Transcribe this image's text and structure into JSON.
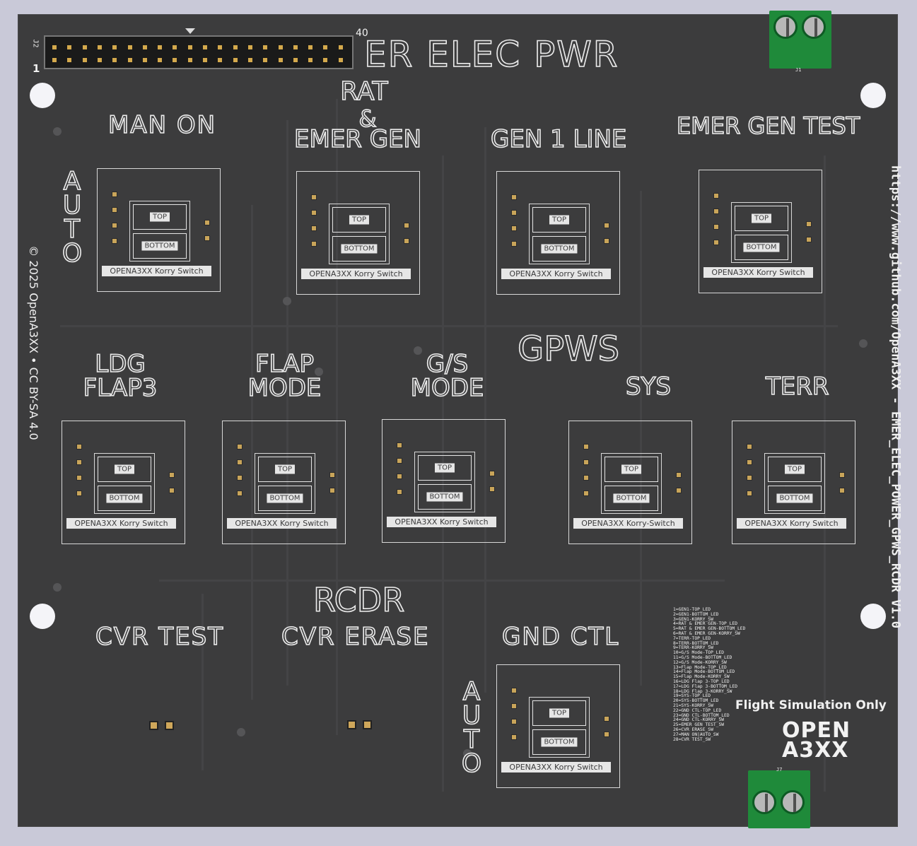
{
  "board": {
    "headers": {
      "title_top": "ER ELEC PWR",
      "rat_emer_gen": [
        "RAT",
        "&",
        "EMER GEN"
      ],
      "man_on": "MAN ON",
      "gen1_line": "GEN 1 LINE",
      "emer_gen_test": "EMER GEN TEST",
      "gpws": "GPWS",
      "ldg_flap3": [
        "LDG",
        "FLAP3"
      ],
      "flap_mode": [
        "FLAP",
        "MODE"
      ],
      "gs_mode": [
        "G/S",
        "MODE"
      ],
      "sys": "SYS",
      "terr": "TERR",
      "rcdr": "RCDR",
      "cvr_test": "CVR TEST",
      "cvr_erase": "CVR ERASE",
      "gnd_ctl": "GND CTL",
      "auto": "AUTO"
    },
    "switch": {
      "top": "TOP",
      "bottom": "BOTTOM",
      "label": "OPENA3XX Korry Switch",
      "label_alt": "OPENA3XX Korry-Switch"
    },
    "connector": {
      "ref": "J2",
      "pin1": "1",
      "pin40": "40",
      "j1": "J1",
      "j7": "J7"
    },
    "side_text": {
      "copyright": "© 2025 OpenA3XX • CC BY-SA 4.0",
      "url": "https://www.github.com/OpenA3XX - EMER_ELEC_POWER_GPWS_RCDR V1.0"
    },
    "pin_legend": [
      "1=GEN1-TOP_LED",
      "2=GEN1-BOTTOM_LED",
      "3=GEN1-KORRY_SW",
      "4=RAT & EMER GEN-TOP_LED",
      "5=RAT & EMER GEN-BOTTOM_LED",
      "6=RAT & EMER GEN-KORRY_SW",
      "7=TERR-TOP_LED",
      "8=TERR-BOTTOM_LED",
      "9=TERR-KORRY_SW",
      "10=G/S Mode-TOP_LED",
      "11=G/S Mode-BOTTOM_LED",
      "12=G/S Mode-KORRY_SW",
      "13=Flap Mode-TOP_LED",
      "14=Flap Mode-BOTTOM_LED",
      "15=Flap Mode-KORRY_SW",
      "16=LDG Flap 3-TOP_LED",
      "17=LDG Flap 3-BOTTOM_LED",
      "18=LDG Flap 3-KORRY_SW",
      "19=SYS-TOP_LED",
      "20=SYS-BOTTOM_LED",
      "21=SYS-KORRY_SW",
      "22=GND CTL-TOP_LED",
      "23=GND CTL-BOTTOM_LED",
      "24=GND CTL-KORRY_SW",
      "25=EMER GEN TEST_SW",
      "26=CVR ERASE_SW",
      "27=MAN ON|AUTO_SW",
      "28=CVR TEST_SW"
    ],
    "flight_sim": "Flight Simulation Only",
    "logo": [
      "OPEN",
      "A3XX"
    ],
    "colors": {
      "board": "#3c3c3d",
      "silkscreen": "#ececec",
      "terminal": "#1f8a3a",
      "background": "#c9c9d8"
    }
  }
}
